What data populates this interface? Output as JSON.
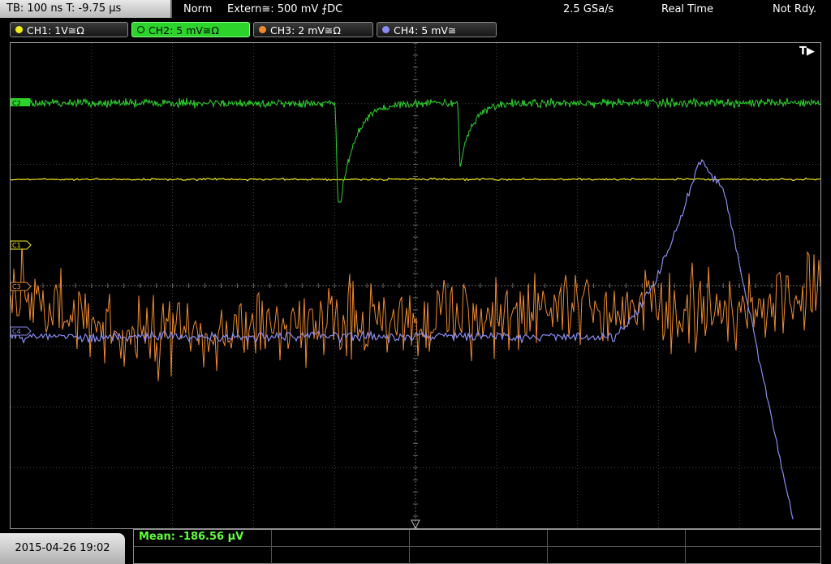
{
  "header": {
    "timebase": "TB: 100 ns   T: -9.75 µs",
    "trigger_mode": "Norm",
    "trigger_source": "Extern≅: 500 mV ⨍DC",
    "sample_rate": "2.5 GSa/s",
    "acquisition_mode": "Real Time",
    "state": "Not Rdy."
  },
  "channels": [
    {
      "label": "CH1: 1V≅Ω",
      "color": "#f2ee1a",
      "active": false
    },
    {
      "label": "CH2: 5 mV≅Ω",
      "color": "#2bd32b",
      "active": true
    },
    {
      "label": "CH3: 2 mV≅Ω",
      "color": "#f08a30",
      "active": false
    },
    {
      "label": "CH4: 5 mV≅",
      "color": "#8a8cf0",
      "active": false
    }
  ],
  "markers": {
    "trigger_flag": "T▶",
    "ch2_marker": "C2",
    "ch1_marker": "C1",
    "ch3_marker": "C3",
    "ch4_marker": "C4"
  },
  "footer": {
    "datetime": "2015-04-26 19:02",
    "measurement": "Mean: -186.56 µV"
  }
}
